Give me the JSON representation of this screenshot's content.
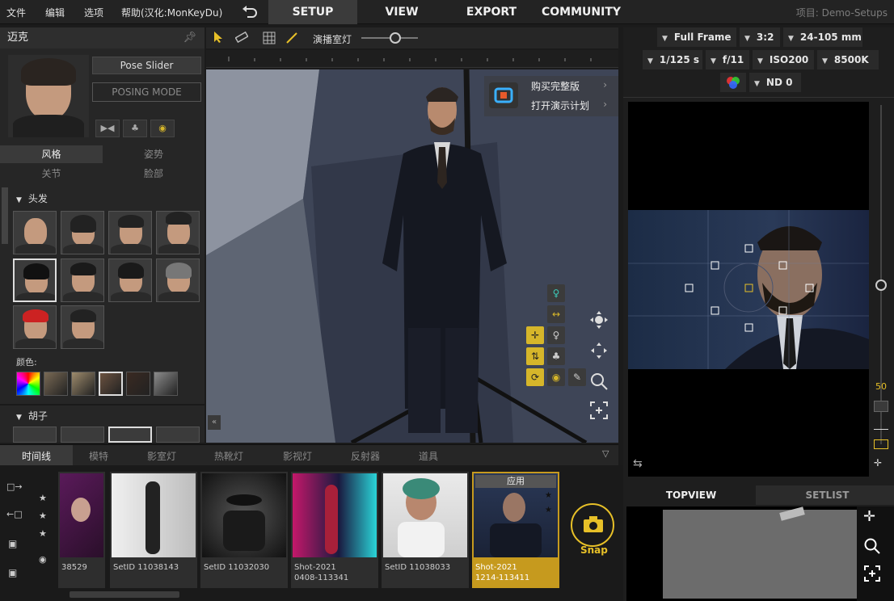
{
  "menu": [
    "文件",
    "编辑",
    "选项",
    "帮助(汉化:MonKeyDu)"
  ],
  "undo_icon": "undo-icon",
  "tabs": [
    "SETUP",
    "VIEW",
    "EXPORT",
    "COMMUNITY"
  ],
  "active_tab": "SETUP",
  "project_label": "项目: Demo-Setups",
  "left_panel": {
    "character_name": "迈克",
    "pose_slider": "Pose Slider",
    "posing_mode": "POSING MODE",
    "subtabs_row1": [
      "风格",
      "姿势"
    ],
    "subtabs_row2": [
      "关节",
      "脸部"
    ],
    "hair_section": "头发",
    "color_label": "颜色:",
    "beard_section": "胡子",
    "hair_colors": [
      "#7a6a55",
      "#9e8b6c",
      "#6b5240",
      "#3a2a22",
      "#8c8c8c",
      "#2b2b2b"
    ]
  },
  "viewport_toolbar": {
    "light_label": "演播室灯"
  },
  "popup": {
    "buy": "购买完整版",
    "demo": "打开演示计划"
  },
  "camera": {
    "sensor": "Full Frame",
    "aspect": "3:2",
    "lens": "24-105 mm",
    "shutter": "1/125 s",
    "aperture": "f/11",
    "iso": "ISO200",
    "wb": "8500K",
    "nd": "ND 0",
    "zoom_value": "50"
  },
  "bottom_tabs": [
    "时间线",
    "模特",
    "影室灯",
    "热靴灯",
    "影视灯",
    "反射器",
    "道具"
  ],
  "active_bottom_tab": "时间线",
  "timeline": [
    {
      "caption": "38529",
      "caption2": ""
    },
    {
      "caption": "SetID 11038143",
      "caption2": ""
    },
    {
      "caption": "SetID 11032030",
      "caption2": ""
    },
    {
      "caption": "Shot-2021",
      "caption2": "0408-113341"
    },
    {
      "caption": "SetID 11038033",
      "caption2": ""
    },
    {
      "caption": "Shot-2021",
      "caption2": "1214-113411"
    }
  ],
  "apply_label": "应用",
  "snap_label": "Snap",
  "topview_tabs": [
    "TOPVIEW",
    "SETLIST"
  ],
  "active_topview_tab": "TOPVIEW"
}
